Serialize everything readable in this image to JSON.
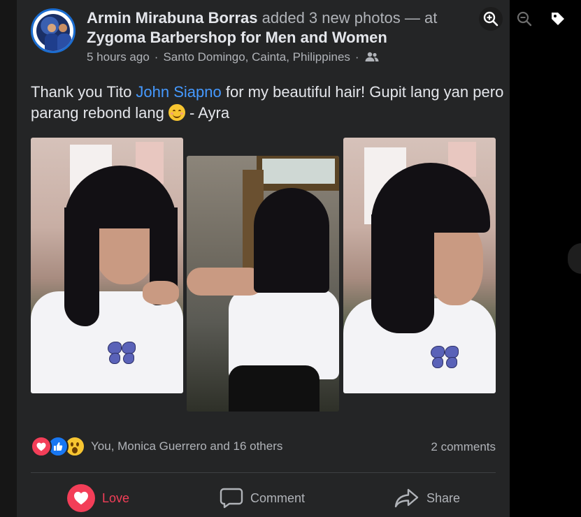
{
  "post": {
    "author": "Armin Mirabuna Borras",
    "action": "added 3 new photos — at",
    "location": "Zygoma Barbershop for Men and Women",
    "time": "5 hours ago",
    "dot": "·",
    "place": "Santo Domingo, Cainta, Philippines",
    "privacy_icon": "friends-icon",
    "caption_before": "Thank you Tito ",
    "mention": "John Siapno",
    "caption_after": " for my beautiful hair! Gupit lang yan pero parang rebond lang ",
    "emoji_name": "smiling-blush-emoji",
    "caption_signature": " - Ayra"
  },
  "photos": [
    {
      "name": "photo-1"
    },
    {
      "name": "photo-2"
    },
    {
      "name": "photo-3"
    }
  ],
  "reactions": {
    "icons": [
      "love",
      "like",
      "wow"
    ],
    "text": "You, Monica Guerrero and 16 others",
    "comments": "2 comments"
  },
  "actions": {
    "love": "Love",
    "comment": "Comment",
    "share": "Share"
  },
  "viewer": {
    "zoom_in_icon": "zoom-in-icon",
    "zoom_out_icon": "zoom-out-icon",
    "tag_icon": "tag-icon"
  },
  "colors": {
    "background": "#242526",
    "mention": "#4599ff",
    "love": "#f33e58",
    "like": "#1877f2",
    "wow": "#f7c531",
    "avatar_ring": "#1b6dd1"
  }
}
